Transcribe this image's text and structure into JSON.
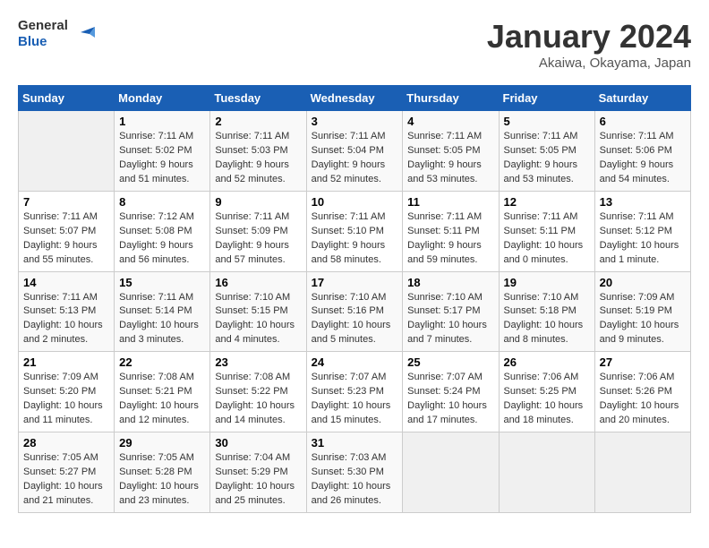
{
  "header": {
    "logo_line1": "General",
    "logo_line2": "Blue",
    "month_title": "January 2024",
    "subtitle": "Akaiwa, Okayama, Japan"
  },
  "columns": [
    "Sunday",
    "Monday",
    "Tuesday",
    "Wednesday",
    "Thursday",
    "Friday",
    "Saturday"
  ],
  "weeks": [
    [
      {
        "day": "",
        "sunrise": "",
        "sunset": "",
        "daylight": ""
      },
      {
        "day": "1",
        "sunrise": "Sunrise: 7:11 AM",
        "sunset": "Sunset: 5:02 PM",
        "daylight": "Daylight: 9 hours and 51 minutes."
      },
      {
        "day": "2",
        "sunrise": "Sunrise: 7:11 AM",
        "sunset": "Sunset: 5:03 PM",
        "daylight": "Daylight: 9 hours and 52 minutes."
      },
      {
        "day": "3",
        "sunrise": "Sunrise: 7:11 AM",
        "sunset": "Sunset: 5:04 PM",
        "daylight": "Daylight: 9 hours and 52 minutes."
      },
      {
        "day": "4",
        "sunrise": "Sunrise: 7:11 AM",
        "sunset": "Sunset: 5:05 PM",
        "daylight": "Daylight: 9 hours and 53 minutes."
      },
      {
        "day": "5",
        "sunrise": "Sunrise: 7:11 AM",
        "sunset": "Sunset: 5:05 PM",
        "daylight": "Daylight: 9 hours and 53 minutes."
      },
      {
        "day": "6",
        "sunrise": "Sunrise: 7:11 AM",
        "sunset": "Sunset: 5:06 PM",
        "daylight": "Daylight: 9 hours and 54 minutes."
      }
    ],
    [
      {
        "day": "7",
        "sunrise": "Sunrise: 7:11 AM",
        "sunset": "Sunset: 5:07 PM",
        "daylight": "Daylight: 9 hours and 55 minutes."
      },
      {
        "day": "8",
        "sunrise": "Sunrise: 7:12 AM",
        "sunset": "Sunset: 5:08 PM",
        "daylight": "Daylight: 9 hours and 56 minutes."
      },
      {
        "day": "9",
        "sunrise": "Sunrise: 7:11 AM",
        "sunset": "Sunset: 5:09 PM",
        "daylight": "Daylight: 9 hours and 57 minutes."
      },
      {
        "day": "10",
        "sunrise": "Sunrise: 7:11 AM",
        "sunset": "Sunset: 5:10 PM",
        "daylight": "Daylight: 9 hours and 58 minutes."
      },
      {
        "day": "11",
        "sunrise": "Sunrise: 7:11 AM",
        "sunset": "Sunset: 5:11 PM",
        "daylight": "Daylight: 9 hours and 59 minutes."
      },
      {
        "day": "12",
        "sunrise": "Sunrise: 7:11 AM",
        "sunset": "Sunset: 5:11 PM",
        "daylight": "Daylight: 10 hours and 0 minutes."
      },
      {
        "day": "13",
        "sunrise": "Sunrise: 7:11 AM",
        "sunset": "Sunset: 5:12 PM",
        "daylight": "Daylight: 10 hours and 1 minute."
      }
    ],
    [
      {
        "day": "14",
        "sunrise": "Sunrise: 7:11 AM",
        "sunset": "Sunset: 5:13 PM",
        "daylight": "Daylight: 10 hours and 2 minutes."
      },
      {
        "day": "15",
        "sunrise": "Sunrise: 7:11 AM",
        "sunset": "Sunset: 5:14 PM",
        "daylight": "Daylight: 10 hours and 3 minutes."
      },
      {
        "day": "16",
        "sunrise": "Sunrise: 7:10 AM",
        "sunset": "Sunset: 5:15 PM",
        "daylight": "Daylight: 10 hours and 4 minutes."
      },
      {
        "day": "17",
        "sunrise": "Sunrise: 7:10 AM",
        "sunset": "Sunset: 5:16 PM",
        "daylight": "Daylight: 10 hours and 5 minutes."
      },
      {
        "day": "18",
        "sunrise": "Sunrise: 7:10 AM",
        "sunset": "Sunset: 5:17 PM",
        "daylight": "Daylight: 10 hours and 7 minutes."
      },
      {
        "day": "19",
        "sunrise": "Sunrise: 7:10 AM",
        "sunset": "Sunset: 5:18 PM",
        "daylight": "Daylight: 10 hours and 8 minutes."
      },
      {
        "day": "20",
        "sunrise": "Sunrise: 7:09 AM",
        "sunset": "Sunset: 5:19 PM",
        "daylight": "Daylight: 10 hours and 9 minutes."
      }
    ],
    [
      {
        "day": "21",
        "sunrise": "Sunrise: 7:09 AM",
        "sunset": "Sunset: 5:20 PM",
        "daylight": "Daylight: 10 hours and 11 minutes."
      },
      {
        "day": "22",
        "sunrise": "Sunrise: 7:08 AM",
        "sunset": "Sunset: 5:21 PM",
        "daylight": "Daylight: 10 hours and 12 minutes."
      },
      {
        "day": "23",
        "sunrise": "Sunrise: 7:08 AM",
        "sunset": "Sunset: 5:22 PM",
        "daylight": "Daylight: 10 hours and 14 minutes."
      },
      {
        "day": "24",
        "sunrise": "Sunrise: 7:07 AM",
        "sunset": "Sunset: 5:23 PM",
        "daylight": "Daylight: 10 hours and 15 minutes."
      },
      {
        "day": "25",
        "sunrise": "Sunrise: 7:07 AM",
        "sunset": "Sunset: 5:24 PM",
        "daylight": "Daylight: 10 hours and 17 minutes."
      },
      {
        "day": "26",
        "sunrise": "Sunrise: 7:06 AM",
        "sunset": "Sunset: 5:25 PM",
        "daylight": "Daylight: 10 hours and 18 minutes."
      },
      {
        "day": "27",
        "sunrise": "Sunrise: 7:06 AM",
        "sunset": "Sunset: 5:26 PM",
        "daylight": "Daylight: 10 hours and 20 minutes."
      }
    ],
    [
      {
        "day": "28",
        "sunrise": "Sunrise: 7:05 AM",
        "sunset": "Sunset: 5:27 PM",
        "daylight": "Daylight: 10 hours and 21 minutes."
      },
      {
        "day": "29",
        "sunrise": "Sunrise: 7:05 AM",
        "sunset": "Sunset: 5:28 PM",
        "daylight": "Daylight: 10 hours and 23 minutes."
      },
      {
        "day": "30",
        "sunrise": "Sunrise: 7:04 AM",
        "sunset": "Sunset: 5:29 PM",
        "daylight": "Daylight: 10 hours and 25 minutes."
      },
      {
        "day": "31",
        "sunrise": "Sunrise: 7:03 AM",
        "sunset": "Sunset: 5:30 PM",
        "daylight": "Daylight: 10 hours and 26 minutes."
      },
      {
        "day": "",
        "sunrise": "",
        "sunset": "",
        "daylight": ""
      },
      {
        "day": "",
        "sunrise": "",
        "sunset": "",
        "daylight": ""
      },
      {
        "day": "",
        "sunrise": "",
        "sunset": "",
        "daylight": ""
      }
    ]
  ]
}
